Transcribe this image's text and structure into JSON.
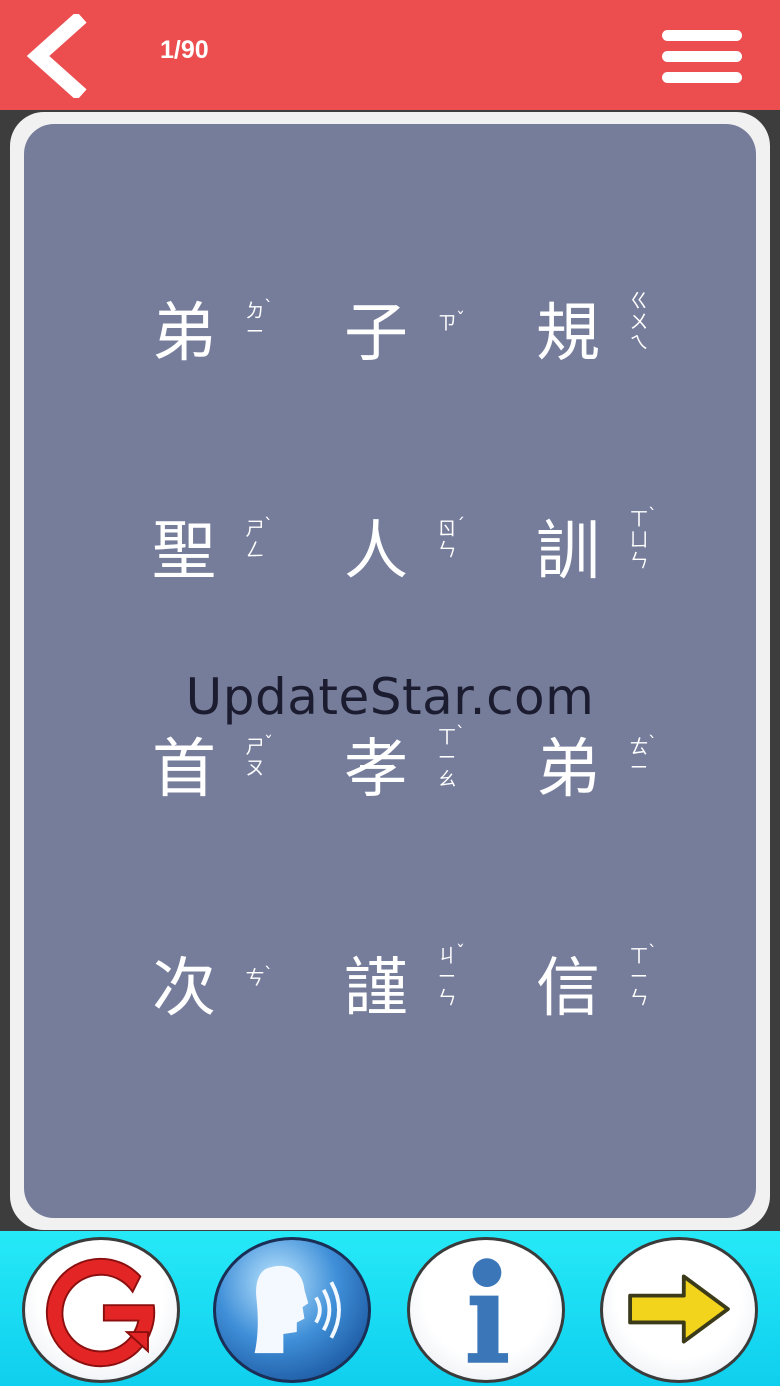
{
  "header": {
    "back_icon": "chevron-left-icon",
    "page_counter": "1/90",
    "menu_icon": "hamburger-menu-icon"
  },
  "card": {
    "rows": [
      [
        {
          "char": "弟",
          "zhuyin": [
            "ㄉ",
            "ㄧ"
          ],
          "tone": "ˋ"
        },
        {
          "char": "子",
          "zhuyin": [
            "ㄗ"
          ],
          "tone": "ˇ"
        },
        {
          "char": "規",
          "zhuyin": [
            "ㄍ",
            "ㄨ",
            "ㄟ"
          ],
          "tone": ""
        }
      ],
      [
        {
          "char": "聖",
          "zhuyin": [
            "ㄕ",
            "ㄥ"
          ],
          "tone": "ˋ"
        },
        {
          "char": "人",
          "zhuyin": [
            "ㄖ",
            "ㄣ"
          ],
          "tone": "ˊ"
        },
        {
          "char": "訓",
          "zhuyin": [
            "ㄒ",
            "ㄩ",
            "ㄣ"
          ],
          "tone": "ˋ"
        }
      ],
      [
        {
          "char": "首",
          "zhuyin": [
            "ㄕ",
            "ㄡ"
          ],
          "tone": "ˇ"
        },
        {
          "char": "孝",
          "zhuyin": [
            "ㄒ",
            "ㄧ",
            "ㄠ"
          ],
          "tone": "ˋ"
        },
        {
          "char": "弟",
          "zhuyin": [
            "ㄊ",
            "ㄧ"
          ],
          "tone": "ˋ"
        }
      ],
      [
        {
          "char": "次",
          "zhuyin": [
            "ㄘ"
          ],
          "tone": "ˋ"
        },
        {
          "char": "謹",
          "zhuyin": [
            "ㄐ",
            "ㄧ",
            "ㄣ"
          ],
          "tone": "ˇ"
        },
        {
          "char": "信",
          "zhuyin": [
            "ㄒ",
            "ㄧ",
            "ㄣ"
          ],
          "tone": "ˋ"
        }
      ]
    ]
  },
  "watermark": "UpdateStar.com",
  "toolbar": {
    "buttons": [
      {
        "icon": "google-g-icon"
      },
      {
        "icon": "speak-voice-icon"
      },
      {
        "icon": "info-icon"
      },
      {
        "icon": "arrow-right-icon"
      }
    ]
  },
  "colors": {
    "header_bg": "#ec4d4f",
    "card_bg": "#767d9b",
    "toolbar_bg": "#1fdff4",
    "arrow_yellow": "#f2d41c",
    "info_blue": "#3a76b8"
  }
}
